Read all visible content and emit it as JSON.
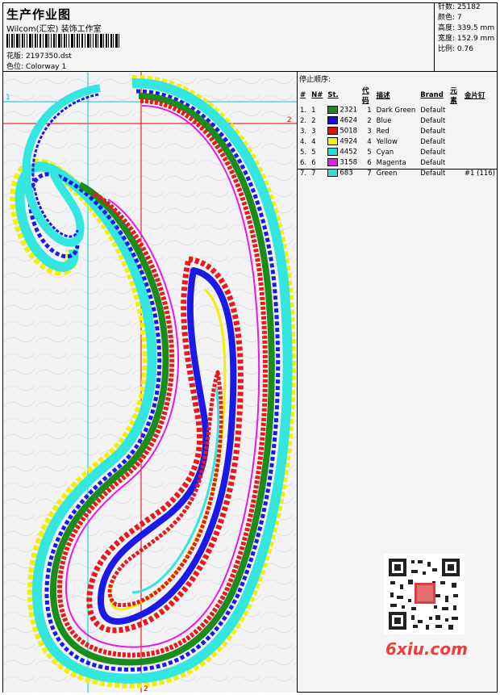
{
  "header": {
    "title": "生产作业图",
    "company": "Wilcom(汇宏) 装饰工作室",
    "design_label": "花版:",
    "design_value": "2197350.dst",
    "colorway_label": "色位:",
    "colorway_value": "Colorway 1"
  },
  "stats": {
    "stitches_label": "针数:",
    "stitches_value": "25182",
    "colors_label": "颜色:",
    "colors_value": "7",
    "height_label": "高度:",
    "height_value": "339.5 mm",
    "width_label": "宽度:",
    "width_value": "152.9 mm",
    "scale_label": "比例:",
    "scale_value": "0.76"
  },
  "sequence": {
    "title": "停止顺序:",
    "headers": {
      "num": "#",
      "n": "N#",
      "st": "St.",
      "code": "代码",
      "desc": "描述",
      "brand": "Brand",
      "elem": "元素",
      "sequin": "金片钉"
    },
    "rows": [
      {
        "num": "1.",
        "n": "1",
        "color": "#1a8c1a",
        "st": "2321",
        "code": "1",
        "desc": "Dark Green",
        "brand": "Default",
        "extra": ""
      },
      {
        "num": "2.",
        "n": "2",
        "color": "#1010e0",
        "st": "4624",
        "code": "2",
        "desc": "Blue",
        "brand": "Default",
        "extra": ""
      },
      {
        "num": "3.",
        "n": "3",
        "color": "#e01010",
        "st": "5018",
        "code": "3",
        "desc": "Red",
        "brand": "Default",
        "extra": ""
      },
      {
        "num": "4.",
        "n": "4",
        "color": "#f0f010",
        "st": "4924",
        "code": "4",
        "desc": "Yellow",
        "brand": "Default",
        "extra": ""
      },
      {
        "num": "5.",
        "n": "5",
        "color": "#20e0e0",
        "st": "4452",
        "code": "5",
        "desc": "Cyan",
        "brand": "Default",
        "extra": ""
      },
      {
        "num": "6.",
        "n": "6",
        "color": "#e020e0",
        "st": "3158",
        "code": "6",
        "desc": "Magenta",
        "brand": "Default",
        "extra": ""
      },
      {
        "num": "7.",
        "n": "7",
        "color": "#30e0d0",
        "st": "683",
        "code": "7",
        "desc": "Green",
        "brand": "Default",
        "extra": "#1 (116)"
      }
    ]
  },
  "guides": {
    "h1": "1",
    "h2": "2",
    "v2": "2"
  },
  "watermark": "6xiu.com",
  "colors": {
    "cyan": "#33e6e0",
    "yellow": "#f4f000",
    "blue": "#1a1ae6",
    "red": "#e61a1a",
    "green": "#1a8c1a",
    "magenta": "#e61ae6",
    "guide_cyan": "#00c8c8",
    "guide_red": "#e00000"
  }
}
